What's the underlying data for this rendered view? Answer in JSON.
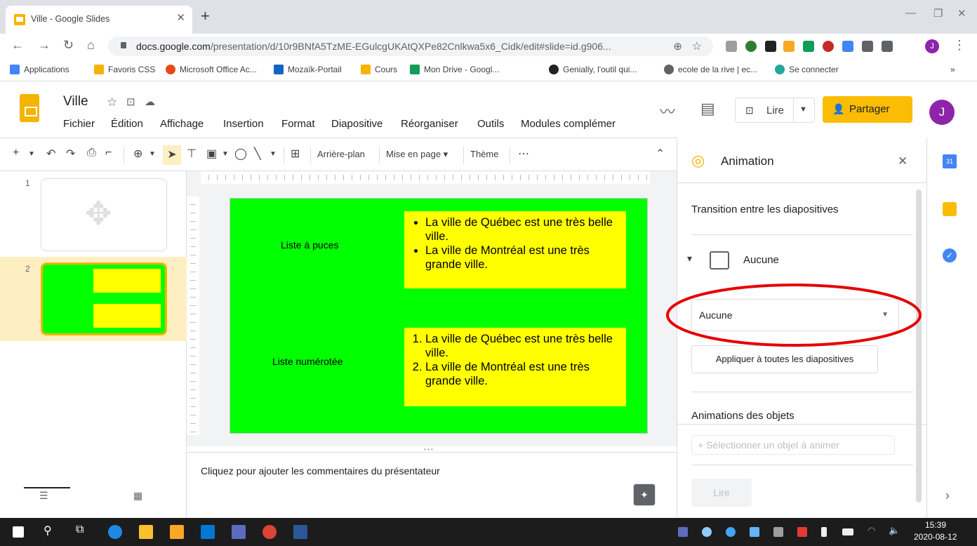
{
  "browser": {
    "tab_title": "Ville - Google Slides",
    "url_host": "docs.google.com",
    "url_path": "/presentation/d/10r9BNfA5TzME-EGulcgUKAtQXPe82Cnlkwa5x6_Cidk/edit#slide=id.g906...",
    "profile_initial": "J"
  },
  "bookmarks": [
    "Applications",
    "Favoris CSS",
    "Microsoft Office Ac...",
    "Mozaïk-Portail",
    "Cours",
    "Mon Drive - Googl...",
    "Genially, l'outil qui...",
    "ecole de la rive | ec...",
    "Se connecter"
  ],
  "doc": {
    "title": "Ville",
    "menu": [
      "Fichier",
      "Édition",
      "Affichage",
      "Insertion",
      "Format",
      "Diapositive",
      "Réorganiser",
      "Outils",
      "Modules complémer"
    ],
    "lire": "Lire",
    "partager": "Partager",
    "avatar": "J"
  },
  "toolbar": {
    "arriere_plan": "Arrière-plan",
    "mise_en_page": "Mise en page",
    "theme": "Thème"
  },
  "filmstrip": {
    "slide_numbers": [
      "1",
      "2"
    ]
  },
  "slide": {
    "label1": "Liste à puces",
    "bullets": [
      "La ville de Québec est une très belle ville.",
      "La ville de Montréal est une très grande ville."
    ],
    "label2": "Liste numérotée",
    "numbered": [
      "La ville de Québec est une très belle ville.",
      "La ville de Montréal est une très grande ville."
    ]
  },
  "notes_placeholder": "Cliquez pour ajouter les commentaires du présentateur",
  "panel": {
    "title": "Animation",
    "transition_heading": "Transition entre les diapositives",
    "transition_current": "Aucune",
    "dropdown_value": "Aucune",
    "apply_all": "Appliquer à toutes les diapositives",
    "objects_heading": "Animations des objets",
    "select_object": "Sélectionner un objet à animer",
    "play": "Lire"
  },
  "taskbar": {
    "time": "15:39",
    "date": "2020-08-12"
  },
  "colors": {
    "accent_yellow": "#fbbc04",
    "slide_bg": "#00ff00",
    "textbox_bg": "#ffff00",
    "annotation": "#e60000"
  }
}
